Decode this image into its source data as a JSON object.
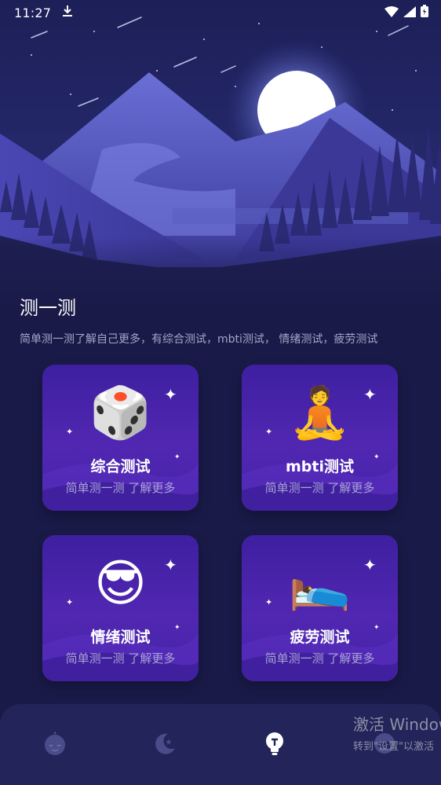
{
  "status_bar": {
    "time": "11:27",
    "download_icon": "download-icon",
    "wifi_icon": "wifi-icon",
    "signal_icon": "signal-icon",
    "battery_icon": "battery-icon"
  },
  "header": {
    "title": "测一测",
    "subtitle": "简单测一测了解自己更多，有综合测试，mbti测试， 情绪测试，疲劳测试"
  },
  "cards": [
    {
      "title": "综合测试",
      "subtitle": "简单测一测 了解更多",
      "icon": "dice-icon",
      "emoji": "🎲"
    },
    {
      "title": "mbti测试",
      "subtitle": "简单测一测 了解更多",
      "icon": "meditation-icon",
      "emoji": "🧘"
    },
    {
      "title": "情绪测试",
      "subtitle": "简单测一测 了解更多",
      "icon": "sunglasses-face-icon",
      "emoji": "😎"
    },
    {
      "title": "疲劳测试",
      "subtitle": "简单测一测 了解更多",
      "icon": "bed-icon",
      "emoji": "🛌"
    }
  ],
  "bottom_nav": {
    "items": [
      {
        "icon": "sleeping-face-icon",
        "active": false
      },
      {
        "icon": "moon-star-icon",
        "active": false
      },
      {
        "icon": "lightbulb-icon",
        "active": true
      },
      {
        "icon": "cloud-icon",
        "active": false
      }
    ]
  },
  "watermark": {
    "line1": "激活 Windows",
    "line2": "转到\"设置\"以激活"
  },
  "colors": {
    "background": "#191a47",
    "card": "#4a24ac",
    "nav_bg": "#22245a",
    "subtitle_text": "#a4a6c8"
  }
}
